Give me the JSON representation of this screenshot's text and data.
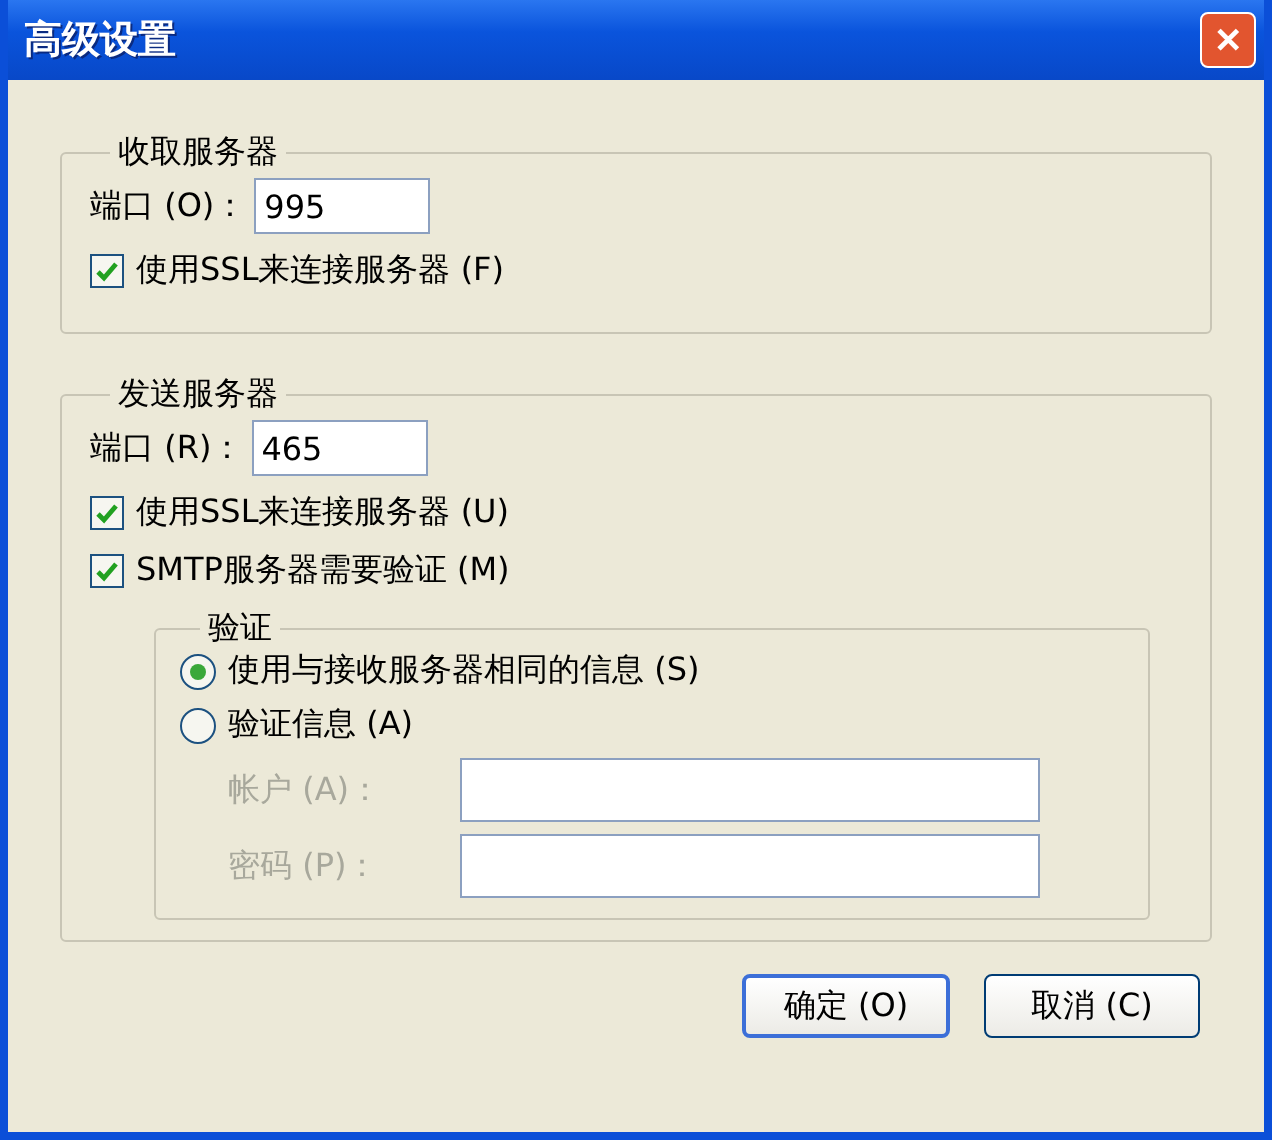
{
  "window": {
    "title": "高级设置",
    "close": "✕"
  },
  "incoming": {
    "legend": "收取服务器",
    "port_label": "端口 (O)：",
    "port_value": "995",
    "options": [
      {
        "label": "使用SSL来连接服务器 (F)",
        "checked": true
      }
    ]
  },
  "outgoing": {
    "legend": "发送服务器",
    "port_label": "端口 (R)：",
    "port_value": "465",
    "options": [
      {
        "label": "使用SSL来连接服务器 (U)",
        "checked": true
      },
      {
        "label": "SMTP服务器需要验证 (M)",
        "checked": true
      }
    ],
    "auth": {
      "legend": "验证",
      "choices": [
        {
          "label": "使用与接收服务器相同的信息 (S)",
          "selected": true
        },
        {
          "label": "验证信息 (A)",
          "selected": false
        }
      ],
      "fields": [
        {
          "label": "帐户 (A)：",
          "disabled": true
        },
        {
          "label": "密码 (P)：",
          "disabled": true
        }
      ]
    }
  },
  "buttons": [
    {
      "label": "确定 (O)",
      "default": true
    },
    {
      "label": "取消 (C)",
      "default": false
    }
  ]
}
